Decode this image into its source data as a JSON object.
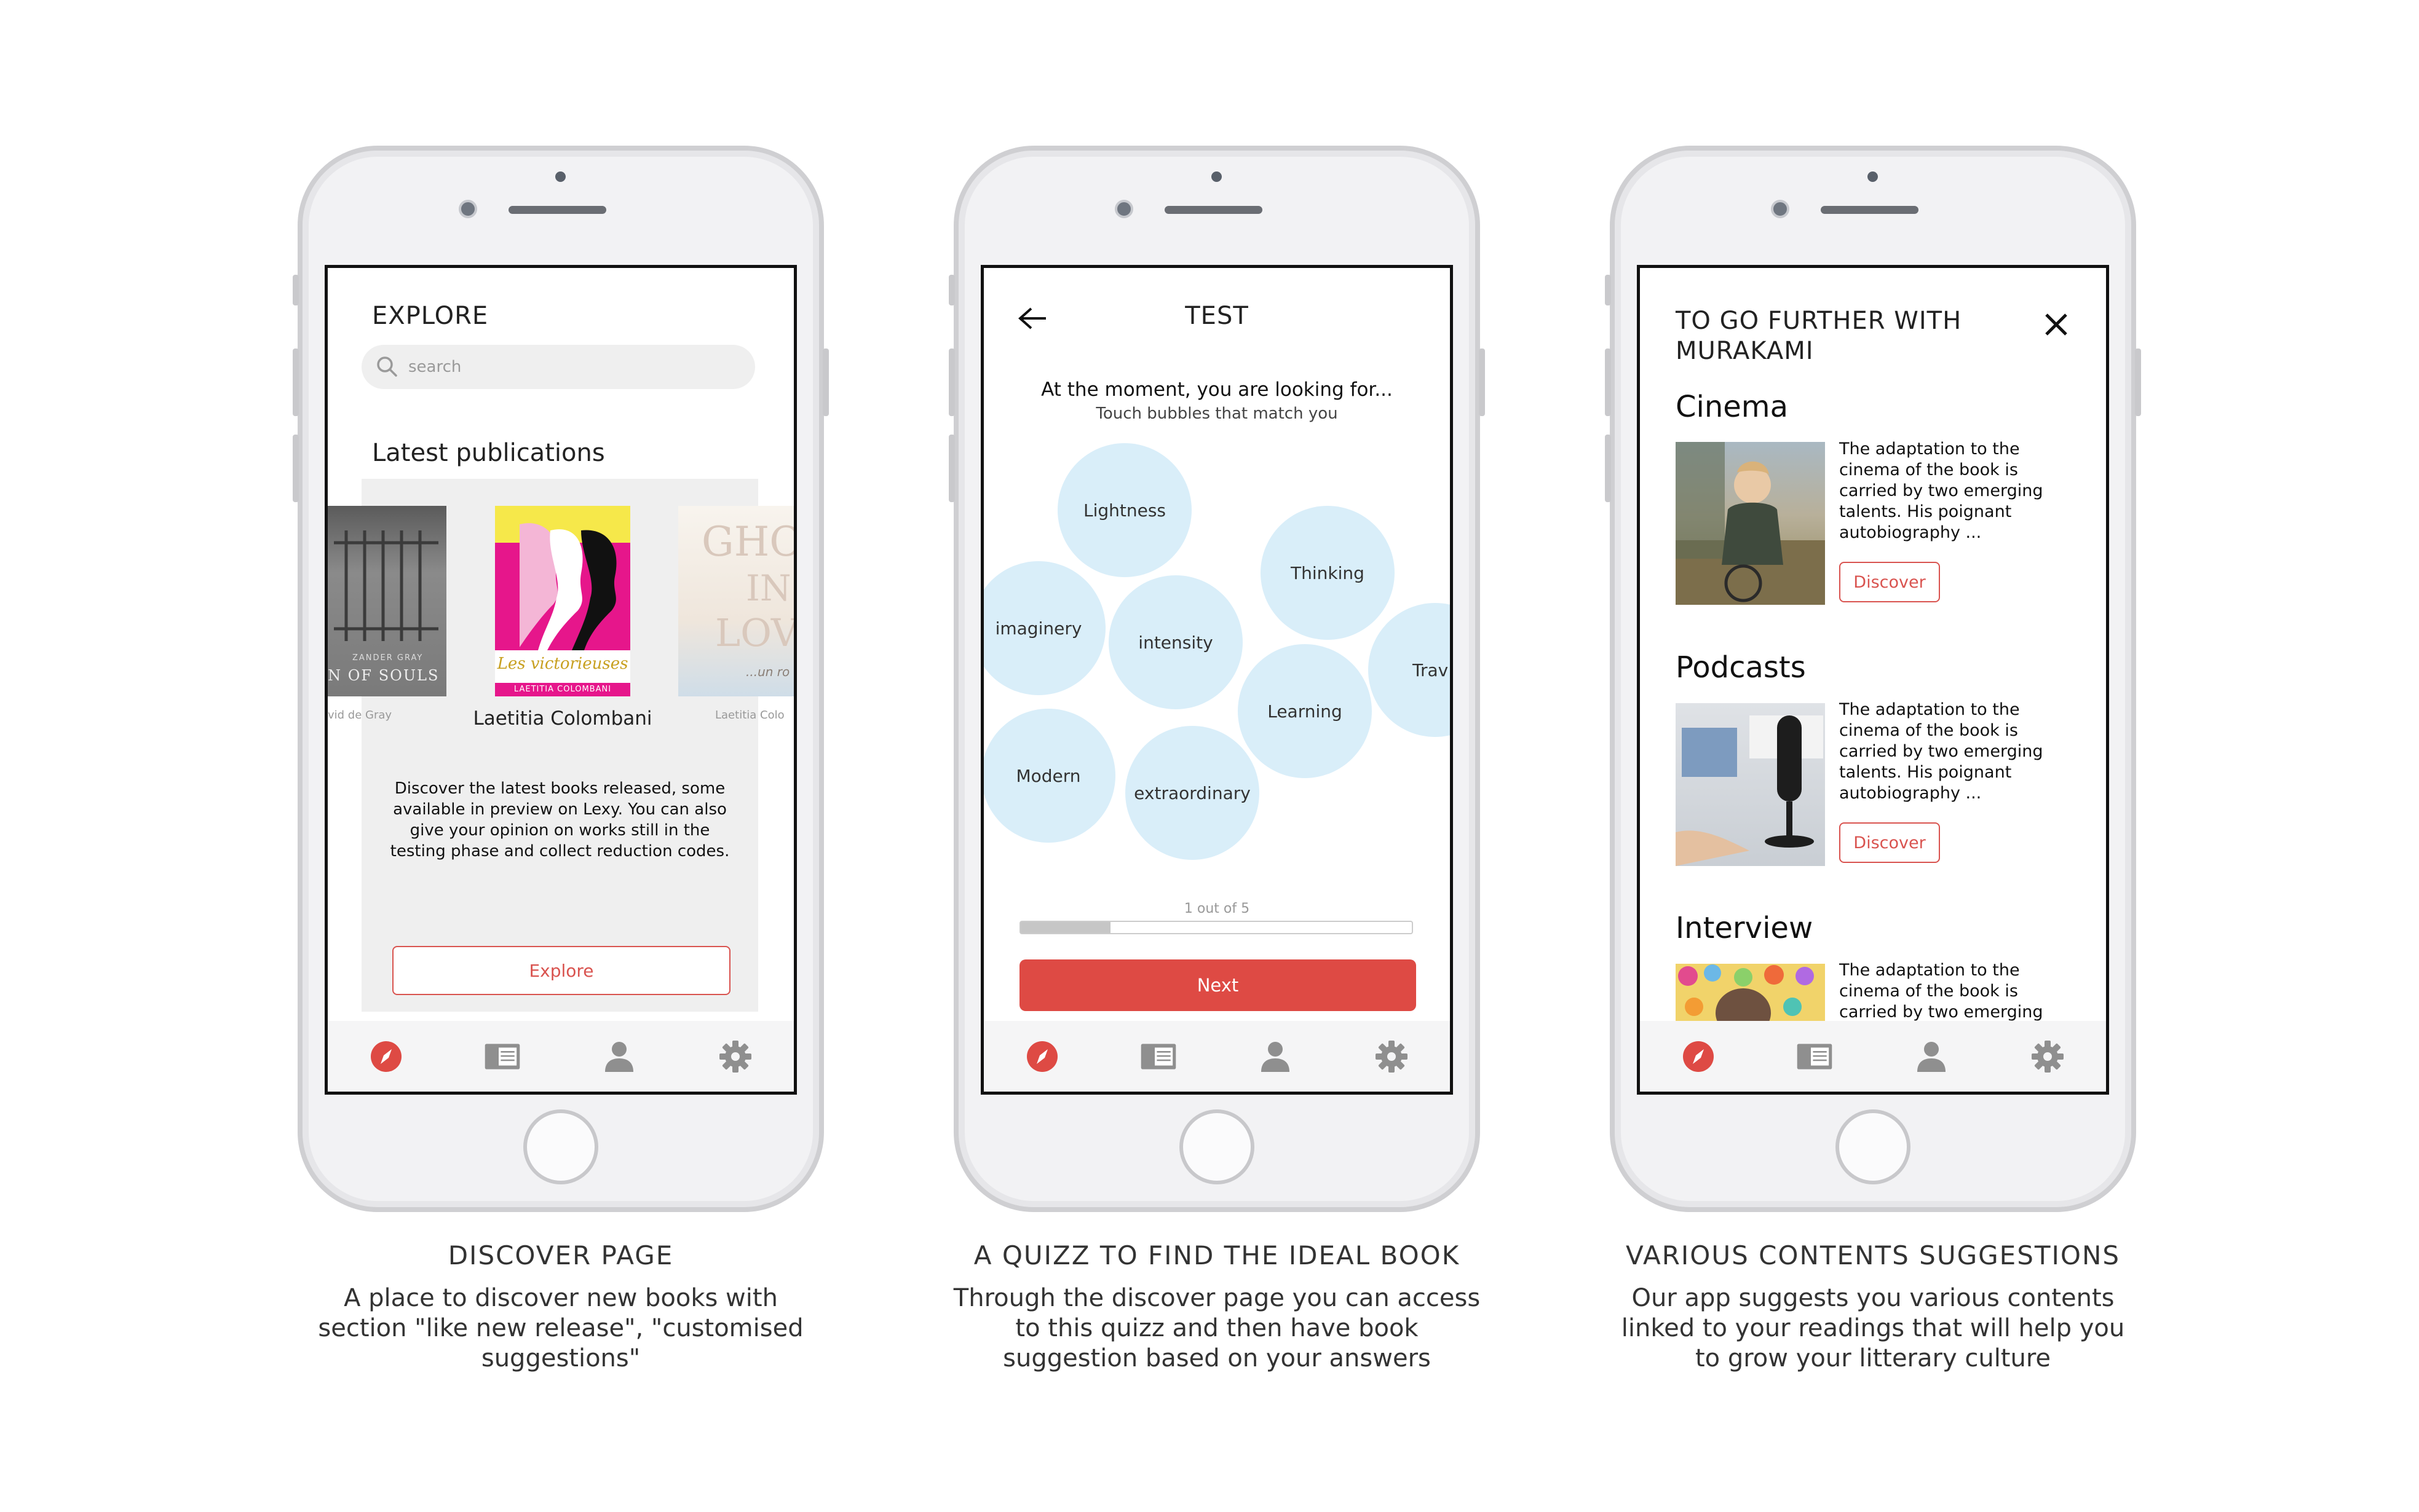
{
  "colors": {
    "accent": "#de4a44",
    "bubble": "#d9eef9",
    "tab_inactive": "#8f8f8f"
  },
  "tabbar": {
    "icons": [
      "compass-icon",
      "book-icon",
      "user-icon",
      "gear-icon"
    ]
  },
  "discover_screen": {
    "title": "EXPLORE",
    "search_placeholder": "search",
    "section_title": "Latest publications",
    "books": [
      {
        "cover_title": "SON OF SOULS",
        "cover_author_top": "ZANDER GRAY",
        "author": "vid de Gray"
      },
      {
        "cover_title": "Les victorieuses",
        "cover_author": "LAETITIA COLOMBANI",
        "author": "Laetitia Colombani"
      },
      {
        "cover_title_line1": "GHOS",
        "cover_title_line2": "IN",
        "cover_title_line3": "LOVE",
        "cover_subtitle": "...un ro",
        "author": "Laetitia Colo"
      }
    ],
    "description": "Discover the latest books released, some available in preview on Lexy. You can also give your opinion on works still in the testing phase and collect reduction codes.",
    "explore_button": "Explore"
  },
  "quiz_screen": {
    "title": "TEST",
    "question": "At the moment, you are looking for...",
    "hint": "Touch bubbles that match you",
    "bubbles": [
      "Lightness",
      "Thinking",
      "imaginery",
      "intensity",
      "Trav",
      "Learning",
      "Modern",
      "extraordinary"
    ],
    "progress_label": "1 out of  5",
    "progress_fraction": 0.23,
    "next_button": "Next"
  },
  "further_screen": {
    "title": "TO GO FURTHER WITH MURAKAMI",
    "sections": [
      {
        "title": "Cinema",
        "text": "The adaptation to the cinema of the book is carried by two emerging talents. His poignant autobiography ...",
        "button": "Discover"
      },
      {
        "title": "Podcasts",
        "text": "The adaptation to the cinema of the book is carried by two emerging talents. His poignant autobiography ...",
        "button": "Discover"
      },
      {
        "title": "Interview",
        "text": "The adaptation to the cinema of the book is carried by two emerging"
      }
    ]
  },
  "captions": [
    {
      "title": "DISCOVER PAGE",
      "text": "A place to discover new books with section \"like new release\", \"customised suggestions\""
    },
    {
      "title": "A QUIZZ TO FIND THE IDEAL BOOK",
      "text": "Through the discover page you can access to this quizz and then have book suggestion based on your answers"
    },
    {
      "title": "VARIOUS CONTENTS SUGGESTIONS",
      "text": "Our app suggests you various contents linked to your readings that will help you to grow your litterary culture"
    }
  ]
}
